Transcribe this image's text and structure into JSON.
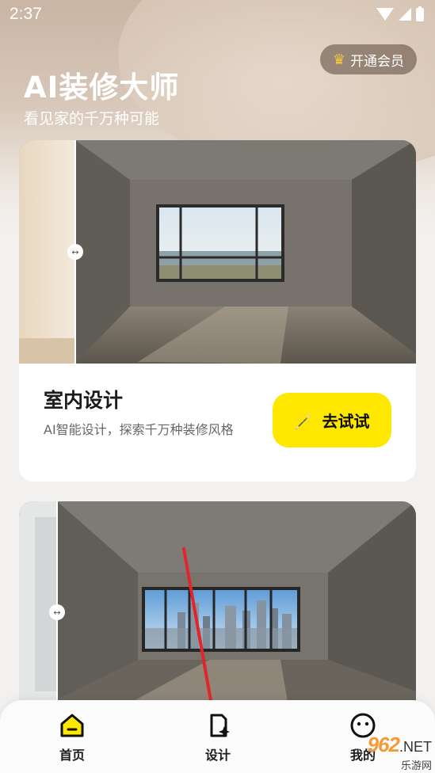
{
  "status_bar": {
    "time": "2:37"
  },
  "header": {
    "title": "AI装修大师",
    "subtitle": "看见家的千万种可能",
    "vip_label": "开通会员"
  },
  "cards": [
    {
      "title": "室内设计",
      "description": "AI智能设计，探索千万种装修风格",
      "button_label": "去试试"
    },
    {
      "title": "",
      "description": "",
      "button_label": ""
    }
  ],
  "nav": {
    "items": [
      {
        "label": "首页",
        "icon": "home-icon"
      },
      {
        "label": "设计",
        "icon": "design-icon"
      },
      {
        "label": "我的",
        "icon": "profile-icon"
      }
    ]
  },
  "watermark": {
    "brand": "962",
    "net": ".NET",
    "sub": "乐游网"
  },
  "colors": {
    "accent": "#ffe700",
    "crown": "#f7c93b",
    "annotation_arrow": "#e0262b"
  }
}
